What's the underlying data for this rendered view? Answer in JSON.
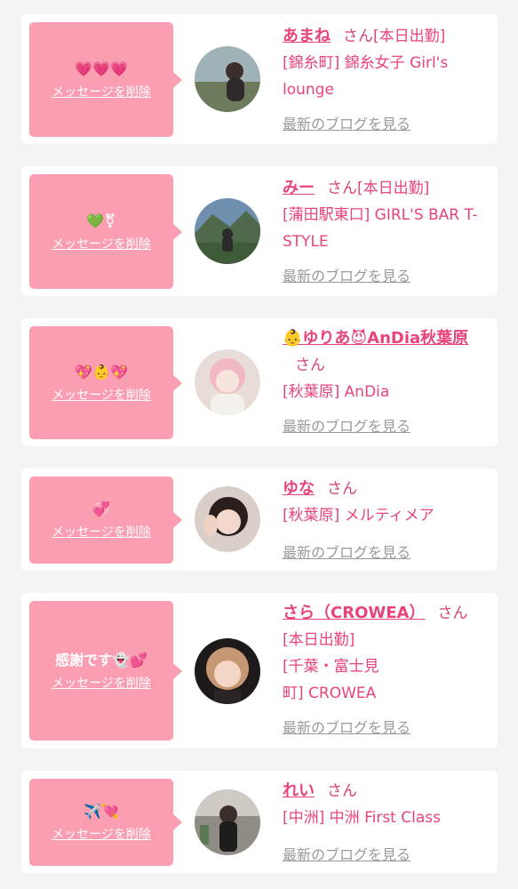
{
  "cards": [
    {
      "message": "💗💗💗",
      "delete_label": "メッセージを削除",
      "name": "あまね",
      "san": "さん",
      "status": "[本日出勤]",
      "shop": "[錦糸町] 錦糸女子 Girl's lounge",
      "blog_label": "最新のブログを見る"
    },
    {
      "message": "💚⚧",
      "delete_label": "メッセージを削除",
      "name": "みー",
      "san": "さん",
      "status": "[本日出勤]",
      "shop": "[蒲田駅東口] GIRL'S BAR T-STYLE",
      "blog_label": "最新のブログを見る"
    },
    {
      "message": "💖👶💖",
      "delete_label": "メッセージを削除",
      "name": "👶ゆりあ😈AnDia秋葉原",
      "san": "さん",
      "status": "",
      "shop": "[秋葉原] AnDia",
      "blog_label": "最新のブログを見る"
    },
    {
      "message": "💞",
      "delete_label": "メッセージを削除",
      "name": "ゆな",
      "san": "さん",
      "status": "",
      "shop": "[秋葉原] メルティメア",
      "blog_label": "最新のブログを見る"
    },
    {
      "message": "感謝です👻💕",
      "delete_label": "メッセージを削除",
      "name": "さら（CROWEA）",
      "san": "さん",
      "status": "[本日出勤]",
      "shop": "[千葉・富士見町] CROWEA",
      "blog_label": "最新のブログを見る"
    },
    {
      "message": "✈️💘",
      "delete_label": "メッセージを削除",
      "name": "れい",
      "san": "さん",
      "status": "",
      "shop": "[中洲] 中洲 First Class",
      "blog_label": "最新のブログを見る"
    }
  ],
  "colors": {
    "bubble": "#fb9eb2",
    "name": "#e8447a",
    "blog_link": "#9a9a9a",
    "background": "#f3f3f3"
  }
}
